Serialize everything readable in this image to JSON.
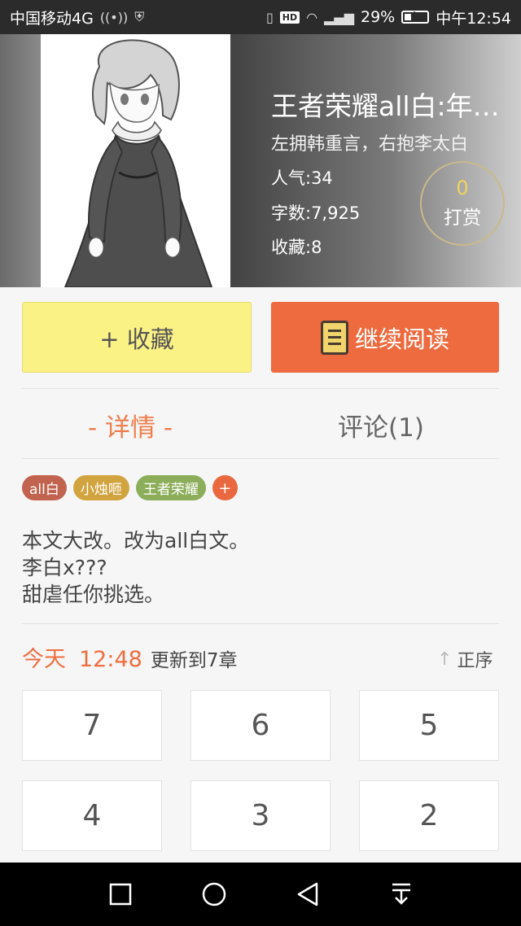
{
  "status_bar": {
    "carrier": "中国移动4G",
    "battery": "29%",
    "time": "中午12:54",
    "battery_level": 0.29,
    "icons": [
      "signal-wifi-icon",
      "shield-icon",
      "vibrate-icon",
      "hd-icon",
      "wifi-icon",
      "cell-signal-icon",
      "battery-icon"
    ]
  },
  "book": {
    "title": "王者荣耀all白:年…",
    "subtitle": "左拥韩重言，右抱李太白",
    "popularity": "人气:34",
    "word_count": "字数:7,925",
    "favorites": "收藏:8",
    "tip_count": "0",
    "tip_label": "打赏"
  },
  "actions": {
    "favorite_label": "+ 收藏",
    "continue_label": "继续阅读"
  },
  "tabs": {
    "details": "- 详情 -",
    "comments": "评论(1)"
  },
  "tags": [
    {
      "label": "all白",
      "color": "#c1634f"
    },
    {
      "label": "小烛咂",
      "color": "#d2a440"
    },
    {
      "label": "王者荣耀",
      "color": "#8cae5a"
    }
  ],
  "tag_add": "+",
  "description": {
    "line1": "本文大改。改为all白文。",
    "line2": "李白x???",
    "line3": "甜虐任你挑选。"
  },
  "update": {
    "day": "今天",
    "time": "12:48",
    "text": "更新到7章",
    "sort_label": "正序"
  },
  "chapters": [
    "7",
    "6",
    "5",
    "4",
    "3",
    "2"
  ],
  "colors": {
    "accent": "#ee6a3f",
    "favorite_bg": "#fbf285",
    "tip_gold": "#f0d35a"
  }
}
